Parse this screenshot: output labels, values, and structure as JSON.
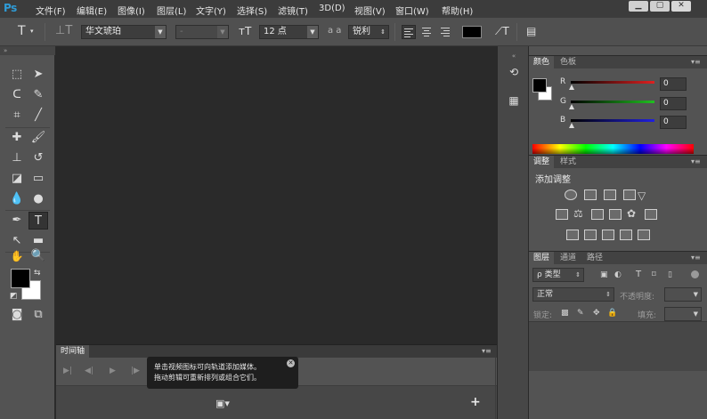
{
  "app": {
    "logo": "Ps",
    "menu": [
      "文件(F)",
      "编辑(E)",
      "图像(I)",
      "图层(L)",
      "文字(Y)",
      "选择(S)",
      "滤镜(T)",
      "3D(D)",
      "视图(V)",
      "窗口(W)",
      "帮助(H)"
    ],
    "window_controls": [
      "minimize",
      "restore",
      "close"
    ]
  },
  "options_bar": {
    "tool_icon": "T",
    "font_family": "华文琥珀",
    "font_style": "-",
    "font_size": "12 点",
    "aa_label": "a a",
    "antialias": "锐利",
    "text_color": "#000000"
  },
  "tools": {
    "foreground_color": "#000000",
    "background_color": "#ffffff",
    "active_tool": "type-tool"
  },
  "timeline": {
    "tab_label": "时间轴",
    "tooltip_line1": "单击视频图标可向轨道添加媒体。",
    "tooltip_line2": "拖动剪辑可重新排列或组合它们。",
    "add_button": "+"
  },
  "color_panel": {
    "tabs": [
      "颜色",
      "色板"
    ],
    "r_label": "R",
    "g_label": "G",
    "b_label": "B",
    "r_value": "0",
    "g_value": "0",
    "b_value": "0",
    "r_color": "#e02020",
    "g_color": "#20c020",
    "b_color": "#2020e0"
  },
  "adjust_panel": {
    "tabs": [
      "调整",
      "样式"
    ],
    "heading": "添加调整"
  },
  "layers_panel": {
    "tabs": [
      "图层",
      "通道",
      "路径"
    ],
    "filter_label": "ρ 类型",
    "blend_mode": "正常",
    "opacity_label": "不透明度:",
    "lock_label": "锁定:",
    "fill_label": "填充:"
  }
}
